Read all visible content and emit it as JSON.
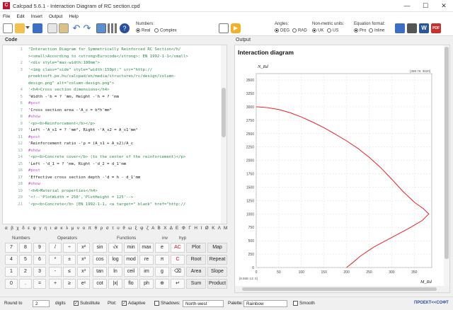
{
  "window": {
    "title": "Calcpad 5.6.1 - Interaction Diagram of RC section.cpd",
    "app_icon": "C",
    "min": "—",
    "max": "☐",
    "close": "✕"
  },
  "menu": [
    "File",
    "Edit",
    "Insert",
    "Output",
    "Help"
  ],
  "toolbar": {
    "numbers_label": "Numbers:",
    "real_label": "Real",
    "complex_label": "Complex",
    "angles_label": "Angles:",
    "deg_label": "DEG",
    "rad_label": "RAD",
    "units_label": "Non-metric units:",
    "uk_label": "UK",
    "us_label": "US",
    "eq_label": "Equation format:",
    "pro_label": "Pro",
    "inline_label": "Inline"
  },
  "code_label": "Code",
  "output_label": "Output",
  "code_lines": [
    {
      "n": "1",
      "cls": "tx",
      "t": "\"Interaction Diagram for Symmetrically Reinforced RC Section</h/"
    },
    {
      "n": "",
      "cls": "tx",
      "t": "><small>According to <strong>Eurocode</strong>: EN 1992-1-1</small>"
    },
    {
      "n": "2",
      "cls": "tx",
      "t": "'<div style=\"max-width:180mm\">"
    },
    {
      "n": "3",
      "cls": "tx",
      "t": "'<img class=\"side\" style=\"width:150pt;\" src=\"http://"
    },
    {
      "n": "",
      "cls": "tx",
      "t": "proektsoft.pe.hu/calcpad/en/media/structures/rc/design/column-"
    },
    {
      "n": "",
      "cls": "tx",
      "t": "design.png\" alt=\"column-design.png\">"
    },
    {
      "n": "4",
      "cls": "tx",
      "t": "'<h4>Cross section dimensions</h4>"
    },
    {
      "n": "5",
      "cls": "ex",
      "t": "'Width -'b = ? 'mm, Height -'h = ? 'mm"
    },
    {
      "n": "6",
      "cls": "kw",
      "t": "#post"
    },
    {
      "n": "7",
      "cls": "ex",
      "t": "'Cross section area -'A_c = b*h'mm²"
    },
    {
      "n": "8",
      "cls": "kw",
      "t": "#show"
    },
    {
      "n": "9",
      "cls": "tx",
      "t": "'<p><b>Reinforcement</b></p>"
    },
    {
      "n": "10",
      "cls": "ex",
      "t": "'Left -'A_s1 = ? 'mm², Right -'A_s2 = A_s1'mm²"
    },
    {
      "n": "11",
      "cls": "kw",
      "t": "#post"
    },
    {
      "n": "12",
      "cls": "ex",
      "t": "'Reinforcement ratio -'ρ = (A_s1 + A_s2)/A_c"
    },
    {
      "n": "13",
      "cls": "kw",
      "t": "#show"
    },
    {
      "n": "14",
      "cls": "tx",
      "t": "'<p><b>Concrete cover</b> (to the center of the reinforcement)</p>"
    },
    {
      "n": "15",
      "cls": "ex",
      "t": "'Left -'d_1 = ? 'mm, Right -'d_2 = d_1'mm"
    },
    {
      "n": "16",
      "cls": "kw",
      "t": "#post"
    },
    {
      "n": "17",
      "cls": "ex",
      "t": "'Effective cross section depth -'d = h - d_1'mm"
    },
    {
      "n": "18",
      "cls": "kw",
      "t": "#show"
    },
    {
      "n": "19",
      "cls": "tx",
      "t": "'<h4>Material properties</h4>"
    },
    {
      "n": "20",
      "cls": "tx",
      "t": "'<!--'PlotWidth = 250','PlotHeight = 125'-->"
    },
    {
      "n": "21",
      "cls": "tx",
      "t": "'<p><b>Concrete</b> [EN 1992-1-1, <a target=\" blank\" href=\"http://"
    }
  ],
  "greek_row": "α β χ δ ε φ γ η ι ø κ λ μ ν ο π θ ρ σ τ υ ϑ ω ξ ψ ζ Α Β Χ Δ Ε Φ Γ Η Ι Ø Κ Λ Μ Ν Ο Π Θ Ρ Σ Τ",
  "keypad": {
    "groups": {
      "numbers": "Numbers",
      "operators": "Operators",
      "functions": "Functions",
      "inv": "inv",
      "hyp": "hyp"
    },
    "keys": [
      [
        "7",
        "8",
        "9",
        "/",
        "÷",
        "x²",
        "sin",
        "√x",
        "min",
        "max",
        "e",
        "AC",
        "Plot",
        "Map"
      ],
      [
        "4",
        "5",
        "6",
        "*",
        "±",
        "x³",
        "cos",
        "log",
        "mod",
        "re",
        "π",
        "C",
        "Root",
        "Repeat"
      ],
      [
        "1",
        "2",
        "3",
        "-",
        "≤",
        "x³",
        "tan",
        "ln",
        "ceil",
        "im",
        "g",
        "⌫",
        "Area",
        "Slope"
      ],
      [
        "0",
        ".",
        "=",
        "+",
        "≥",
        "eˣ",
        "cot",
        "|x|",
        "flo",
        "ph",
        "⊕",
        "↵",
        "Sum",
        "Product"
      ]
    ]
  },
  "status": {
    "round_label": "Round to",
    "round_value": "2",
    "digits_label": "digits",
    "substitute_label": "Substitute",
    "plot_label": "Plot:",
    "adaptive_label": "Adaptive",
    "shadows_label": "Shadows:",
    "shadows_value": "North-west",
    "palette_label": "Palette:",
    "palette_value": "Rainbow",
    "smooth_label": "Smooth",
    "brand": "ПРОЕКТ<<СОФТ"
  },
  "output": {
    "title": "Interaction diagram",
    "y_axis": "N_Rd",
    "x_axis": "M_Rd",
    "top_right_coord": "[388.75; 3620]",
    "bottom_left_coord": "[8.55E-13; 0]"
  },
  "chart_data": {
    "type": "line",
    "title": "Interaction diagram",
    "xlabel": "M_Rd",
    "ylabel": "N_Rd",
    "xlim": [
      0,
      388.75
    ],
    "ylim": [
      0,
      3620
    ],
    "xticks": [
      0,
      50,
      100,
      150,
      200,
      250,
      300,
      350
    ],
    "yticks": [
      0,
      250,
      500,
      750,
      1000,
      1250,
      1500,
      1750,
      2000,
      2250,
      2500,
      2750,
      3000,
      3250,
      3500
    ],
    "line_color": "#e8202a",
    "grid": true,
    "series": [
      {
        "values": [
          [
            0,
            3000
          ],
          [
            25,
            2985
          ],
          [
            50,
            2950
          ],
          [
            75,
            2890
          ],
          [
            100,
            2810
          ],
          [
            125,
            2715
          ],
          [
            150,
            2610
          ],
          [
            175,
            2490
          ],
          [
            200,
            2365
          ],
          [
            225,
            2225
          ],
          [
            250,
            2060
          ],
          [
            275,
            1870
          ],
          [
            300,
            1650
          ],
          [
            325,
            1420
          ],
          [
            350,
            1220
          ],
          [
            370,
            1100
          ],
          [
            382,
            1000
          ],
          [
            368,
            880
          ],
          [
            340,
            740
          ],
          [
            300,
            560
          ],
          [
            260,
            380
          ],
          [
            230,
            210
          ],
          [
            215,
            100
          ],
          [
            200,
            0
          ]
        ]
      }
    ]
  }
}
